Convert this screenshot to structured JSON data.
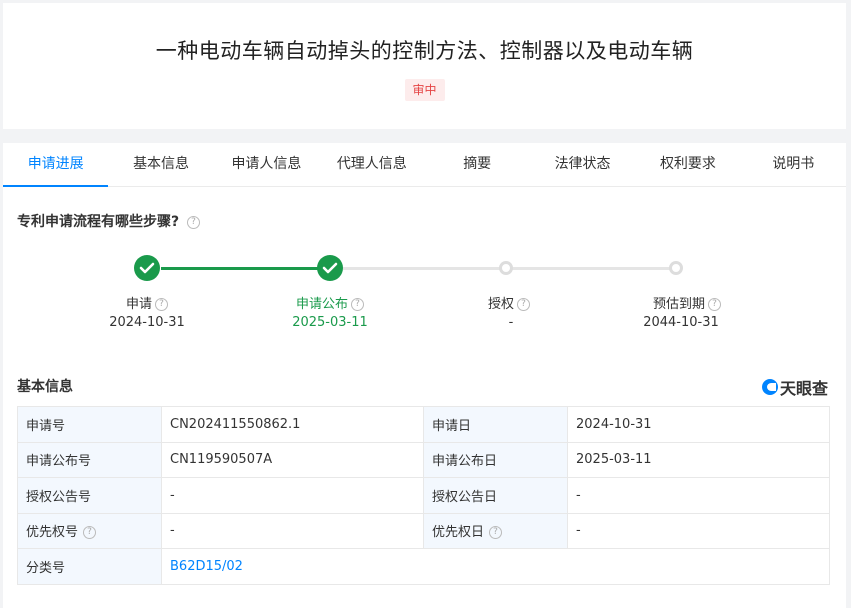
{
  "header": {
    "title": "一种电动车辆自动掉头的控制方法、控制器以及电动车辆",
    "status_badge": "审中"
  },
  "tabs": [
    {
      "label": "申请进展",
      "active": true
    },
    {
      "label": "基本信息",
      "active": false
    },
    {
      "label": "申请人信息",
      "active": false
    },
    {
      "label": "代理人信息",
      "active": false
    },
    {
      "label": "摘要",
      "active": false
    },
    {
      "label": "法律状态",
      "active": false
    },
    {
      "label": "权利要求",
      "active": false
    },
    {
      "label": "说明书",
      "active": false
    }
  ],
  "process": {
    "title": "专利申请流程有哪些步骤?",
    "steps": [
      {
        "label": "申请",
        "date": "2024-10-31",
        "status": "done"
      },
      {
        "label": "申请公布",
        "date": "2025-03-11",
        "status": "current"
      },
      {
        "label": "授权",
        "date": "-",
        "status": "todo"
      },
      {
        "label": "预估到期",
        "date": "2044-10-31",
        "status": "todo"
      }
    ]
  },
  "basic_info": {
    "title": "基本信息",
    "logo_text": "天眼查",
    "rows": [
      {
        "l1": "申请号",
        "v1": "CN202411550862.1",
        "l2": "申请日",
        "v2": "2024-10-31"
      },
      {
        "l1": "申请公布号",
        "v1": "CN119590507A",
        "l2": "申请公布日",
        "v2": "2025-03-11"
      },
      {
        "l1": "授权公告号",
        "v1": "-",
        "l2": "授权公告日",
        "v2": "-"
      },
      {
        "l1": "优先权号",
        "v1": "-",
        "l2": "优先权日",
        "v2": "-"
      }
    ],
    "classification": {
      "label": "分类号",
      "value": "B62D15/02"
    }
  },
  "colors": {
    "accent": "#0084ff",
    "success": "#1a9a4b",
    "badge_bg": "#fdecec",
    "badge_text": "#e54545"
  }
}
